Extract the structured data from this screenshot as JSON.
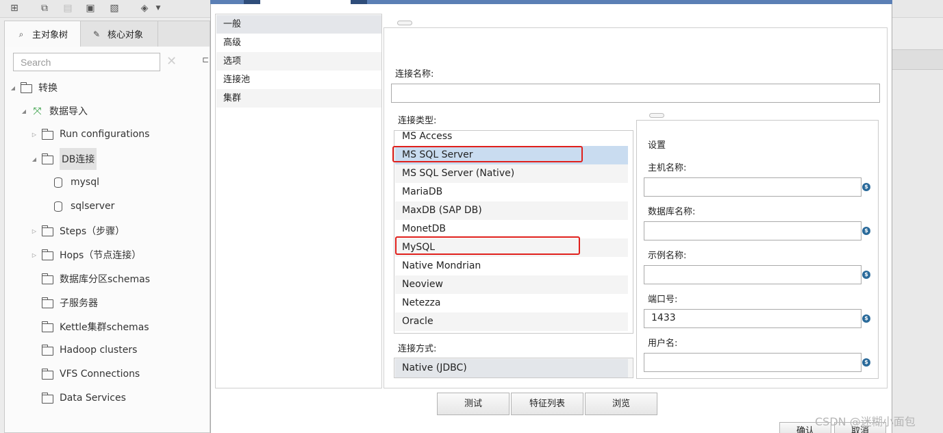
{
  "toolbar": {
    "icons": [
      "new-file-icon",
      "open-file-icon",
      "explore-icon",
      "save-icon",
      "save-as-icon",
      "layers-icon",
      "dropdown-arrow-icon"
    ]
  },
  "left_tabs": [
    {
      "label": "主对象树",
      "icon": "tree-icon"
    },
    {
      "label": "核心对象",
      "icon": "pencil-icon"
    }
  ],
  "search": {
    "placeholder": "Search"
  },
  "tree": {
    "root_label": "转换",
    "transform_label": "数据导入",
    "items": [
      {
        "label": "Run configurations"
      },
      {
        "label": "DB连接"
      },
      {
        "label": "mysql"
      },
      {
        "label": "sqlserver"
      },
      {
        "label": "Steps（步骤）"
      },
      {
        "label": "Hops（节点连接）"
      },
      {
        "label": "数据库分区schemas"
      },
      {
        "label": "子服务器"
      },
      {
        "label": "Kettle集群schemas"
      },
      {
        "label": "Hadoop clusters"
      },
      {
        "label": "VFS Connections"
      },
      {
        "label": "Data Services"
      }
    ]
  },
  "dialog": {
    "nav": [
      "一般",
      "高级",
      "选项",
      "连接池",
      "集群"
    ],
    "connection_name_label": "连接名称:",
    "connection_name_value": "",
    "connection_type_label": "连接类型:",
    "connection_types": [
      "MS Access",
      "MS SQL Server",
      "MS SQL Server (Native)",
      "MariaDB",
      "MaxDB (SAP DB)",
      "MonetDB",
      "MySQL",
      "Native Mondrian",
      "Neoview",
      "Netezza",
      "Oracle"
    ],
    "selected_type": "MS SQL Server",
    "access_label": "连接方式:",
    "access_methods": [
      "Native (JDBC)"
    ],
    "settings": {
      "title": "设置",
      "host_label": "主机名称:",
      "host_value": "",
      "database_label": "数据库名称:",
      "database_value": "",
      "instance_label": "示例名称:",
      "instance_value": "",
      "port_label": "端口号:",
      "port_value": "1433",
      "user_label": "用户名:",
      "user_value": ""
    },
    "buttons": {
      "test": "测试",
      "features": "特征列表",
      "explore": "浏览"
    },
    "bottom_buttons": {
      "ok": "确认",
      "cancel": "取消"
    }
  },
  "watermark": "CSDN @迷糊小面包",
  "colors": {
    "accent": "#5b7fb5",
    "highlight": "#e0201c",
    "selection": "#c9dcf0"
  }
}
